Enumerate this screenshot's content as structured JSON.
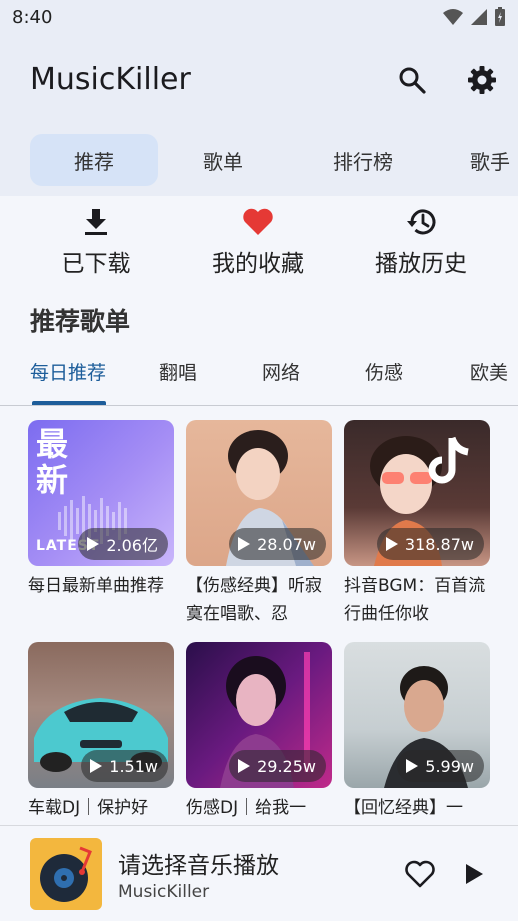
{
  "status": {
    "time": "8:40"
  },
  "header": {
    "title": "MusicKiller"
  },
  "tabs": [
    {
      "label": "推荐",
      "active": true
    },
    {
      "label": "歌单"
    },
    {
      "label": "排行榜"
    },
    {
      "label": "歌手"
    }
  ],
  "quick_actions": [
    {
      "label": "已下载",
      "icon": "download-icon"
    },
    {
      "label": "我的收藏",
      "icon": "heart-icon"
    },
    {
      "label": "播放历史",
      "icon": "history-icon"
    }
  ],
  "section": {
    "title": "推荐歌单"
  },
  "categories": [
    {
      "label": "每日推荐",
      "active": true
    },
    {
      "label": "翻唱"
    },
    {
      "label": "网络"
    },
    {
      "label": "伤感"
    },
    {
      "label": "欧美"
    }
  ],
  "playlists": [
    {
      "title": "每日最新单曲推荐",
      "plays": "2.06亿",
      "cover_text": "最新",
      "cover_sub": "LATEST"
    },
    {
      "title": "【伤感经典】听寂寞在唱歌、忍",
      "plays": "28.07w"
    },
    {
      "title": "抖音BGM：百首流行曲任你收",
      "plays": "318.87w"
    },
    {
      "title": "车载DJ｜保护好",
      "plays": "1.51w"
    },
    {
      "title": "伤感DJ｜给我一",
      "plays": "29.25w"
    },
    {
      "title": "【回忆经典】一",
      "plays": "5.99w"
    }
  ],
  "player": {
    "title": "请选择音乐播放",
    "subtitle": "MusicKiller"
  },
  "colors": {
    "accent": "#1d5d9a",
    "tab_active_bg": "#d6e3f7",
    "heart": "#e53935"
  }
}
